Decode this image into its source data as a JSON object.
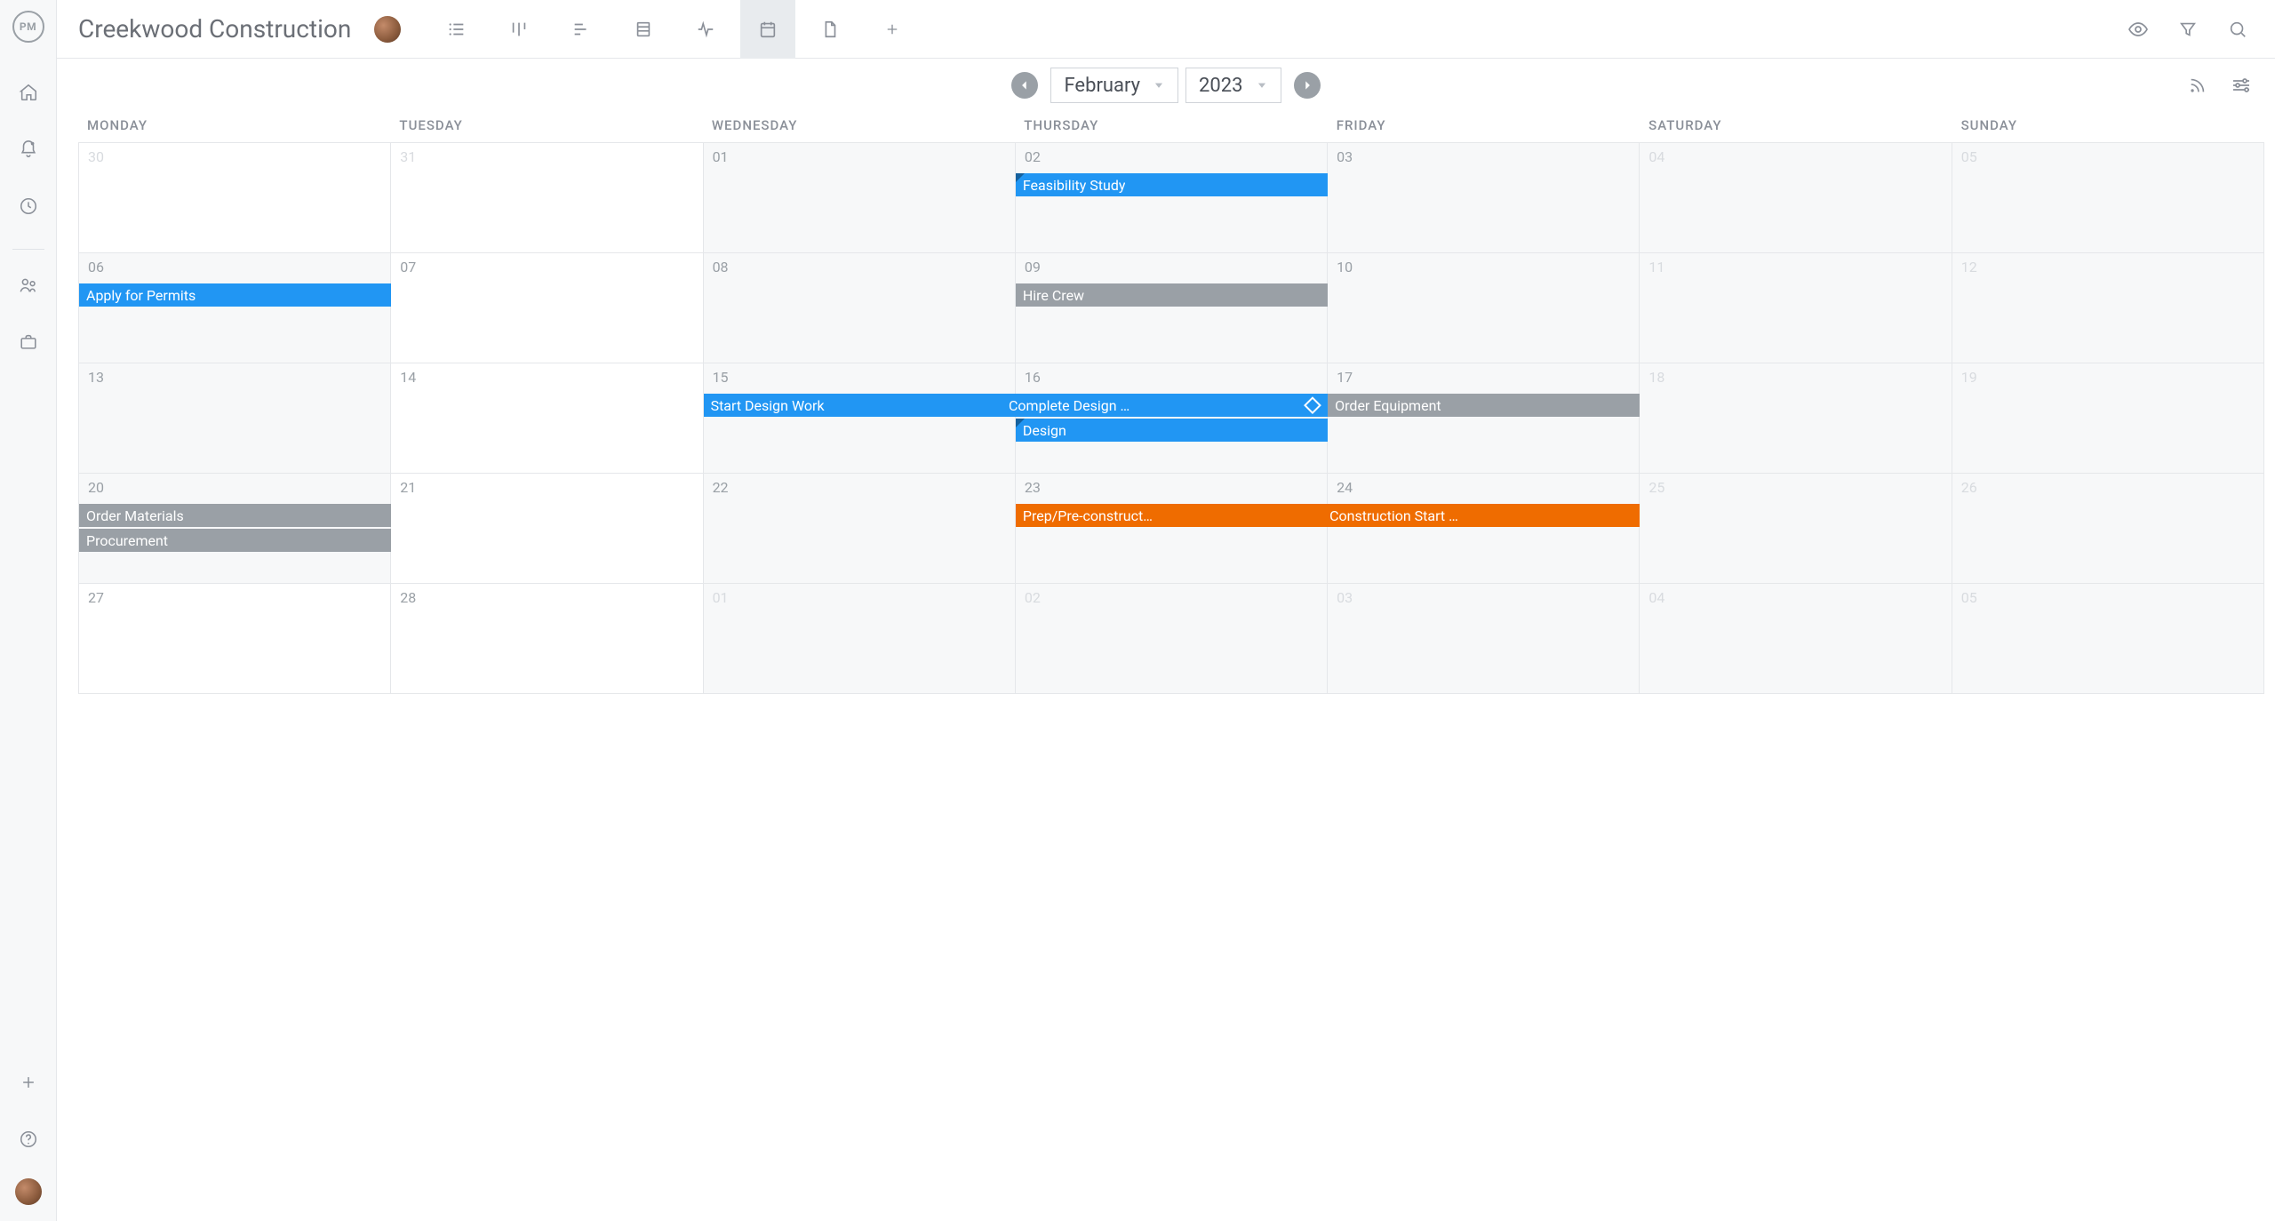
{
  "brand_logo_text": "PM",
  "project_title": "Creekwood Construction",
  "month_selector": {
    "month": "February",
    "year": "2023"
  },
  "day_headers": [
    "MONDAY",
    "TUESDAY",
    "WEDNESDAY",
    "THURSDAY",
    "FRIDAY",
    "SATURDAY",
    "SUNDAY"
  ],
  "weeks": [
    [
      {
        "num": "30",
        "muted": true,
        "off": false
      },
      {
        "num": "31",
        "muted": true,
        "off": false
      },
      {
        "num": "01",
        "muted": false,
        "off": true
      },
      {
        "num": "02",
        "muted": false,
        "off": true
      },
      {
        "num": "03",
        "muted": false,
        "off": true
      },
      {
        "num": "04",
        "muted": true,
        "off": true
      },
      {
        "num": "05",
        "muted": true,
        "off": true
      }
    ],
    [
      {
        "num": "06",
        "muted": false,
        "off": true
      },
      {
        "num": "07",
        "muted": false,
        "off": false
      },
      {
        "num": "08",
        "muted": false,
        "off": true
      },
      {
        "num": "09",
        "muted": false,
        "off": true
      },
      {
        "num": "10",
        "muted": false,
        "off": true
      },
      {
        "num": "11",
        "muted": true,
        "off": true
      },
      {
        "num": "12",
        "muted": true,
        "off": true
      }
    ],
    [
      {
        "num": "13",
        "muted": false,
        "off": true
      },
      {
        "num": "14",
        "muted": false,
        "off": false
      },
      {
        "num": "15",
        "muted": false,
        "off": true
      },
      {
        "num": "16",
        "muted": false,
        "off": true
      },
      {
        "num": "17",
        "muted": false,
        "off": true
      },
      {
        "num": "18",
        "muted": true,
        "off": true
      },
      {
        "num": "19",
        "muted": true,
        "off": true
      }
    ],
    [
      {
        "num": "20",
        "muted": false,
        "off": true
      },
      {
        "num": "21",
        "muted": false,
        "off": false
      },
      {
        "num": "22",
        "muted": false,
        "off": true
      },
      {
        "num": "23",
        "muted": false,
        "off": true
      },
      {
        "num": "24",
        "muted": false,
        "off": true
      },
      {
        "num": "25",
        "muted": true,
        "off": true
      },
      {
        "num": "26",
        "muted": true,
        "off": true
      }
    ],
    [
      {
        "num": "27",
        "muted": false,
        "off": false
      },
      {
        "num": "28",
        "muted": false,
        "off": false
      },
      {
        "num": "01",
        "muted": true,
        "off": true
      },
      {
        "num": "02",
        "muted": true,
        "off": true
      },
      {
        "num": "03",
        "muted": true,
        "off": true
      },
      {
        "num": "04",
        "muted": true,
        "off": true
      },
      {
        "num": "05",
        "muted": true,
        "off": true
      }
    ]
  ],
  "events": [
    {
      "id": "feasibility",
      "label": "Feasibility Study",
      "color": "blue",
      "row": 1,
      "col": 4,
      "span": 1,
      "slot": 0,
      "notch": true
    },
    {
      "id": "apply-permits",
      "label": "Apply for Permits",
      "color": "blue",
      "row": 2,
      "col": 1,
      "span": 1,
      "slot": 0
    },
    {
      "id": "hire-crew",
      "label": "Hire Crew",
      "color": "gray",
      "row": 2,
      "col": 4,
      "span": 1,
      "slot": 0
    },
    {
      "id": "design-span",
      "label": "Start Design Work",
      "label2": "Complete Design …",
      "milestone": true,
      "color": "blue",
      "row": 3,
      "col": 3,
      "span": 2,
      "slot": 0
    },
    {
      "id": "order-equipment",
      "label": "Order Equipment",
      "color": "gray",
      "row": 3,
      "col": 5,
      "span": 1,
      "slot": 0
    },
    {
      "id": "design-phase",
      "label": "Design",
      "color": "blue",
      "row": 3,
      "col": 4,
      "span": 1,
      "slot": 1,
      "notch": true
    },
    {
      "id": "order-materials",
      "label": "Order Materials",
      "color": "gray",
      "row": 4,
      "col": 1,
      "span": 1,
      "slot": 0
    },
    {
      "id": "procurement",
      "label": "Procurement",
      "color": "gray",
      "row": 4,
      "col": 1,
      "span": 1,
      "slot": 1
    },
    {
      "id": "construction-span",
      "label": "Prep/Pre-construct…",
      "label2": "Construction Start …",
      "color": "orange",
      "row": 4,
      "col": 4,
      "span": 2,
      "slot": 0
    }
  ],
  "colors": {
    "blue": "#2196f3",
    "gray": "#9aa0a6",
    "orange": "#ef6c00"
  }
}
